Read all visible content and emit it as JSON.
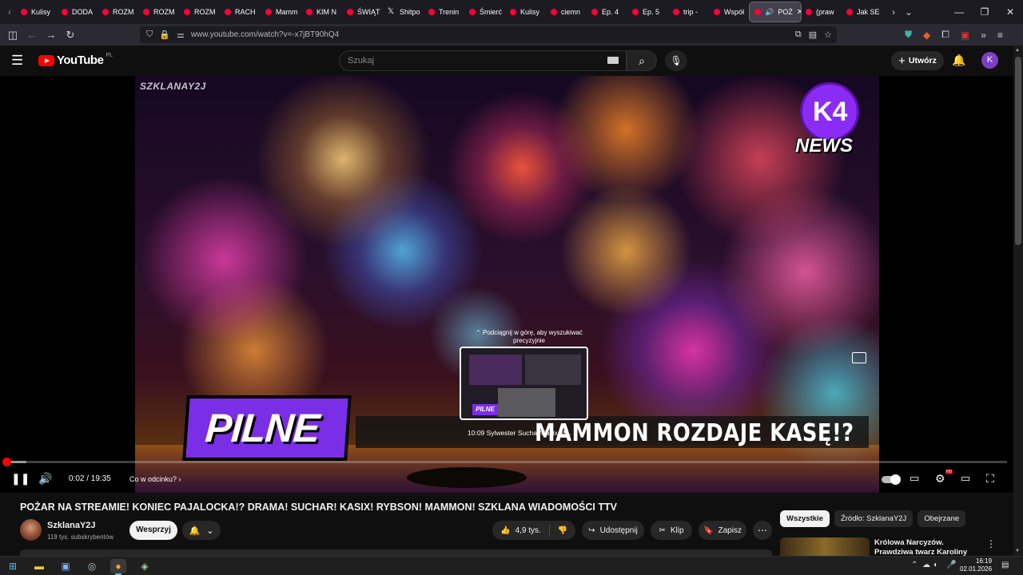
{
  "browser": {
    "tabs": [
      {
        "label": "Kulisy"
      },
      {
        "label": "DODA"
      },
      {
        "label": "ROZM"
      },
      {
        "label": "ROZM"
      },
      {
        "label": "ROZM"
      },
      {
        "label": "RACH"
      },
      {
        "label": "Mamm"
      },
      {
        "label": "KIM N"
      },
      {
        "label": "ŚWIĄT"
      },
      {
        "label": "Shitpo"
      },
      {
        "label": "Trenin"
      },
      {
        "label": "Śmierć"
      },
      {
        "label": "Kulisy"
      },
      {
        "label": "ciemn"
      },
      {
        "label": "Ep. 4"
      },
      {
        "label": "Ep. 5"
      },
      {
        "label": "trip - "
      },
      {
        "label": "Współ"
      },
      {
        "label": "POŻ"
      },
      {
        "label": "(praw"
      },
      {
        "label": "Jak SE"
      }
    ],
    "url": "www.youtube.com/watch?v=-x7jBT90hQ4"
  },
  "youtube": {
    "logo_text": "YouTube",
    "country_code": "PL",
    "search_placeholder": "Szukaj",
    "create_label": "Utwórz",
    "avatar_letter": "K"
  },
  "player": {
    "watermark": "SZKLANAY2J",
    "channel_logo_text": "K4",
    "news_label": "NEWS",
    "pilne_label": "PILNE",
    "ticker_text": "MAMMON ROZDAJE KASĘ!?",
    "scroll_hint": "⌃ Podciągnij w górę, aby wyszukiwać precyzyjnie",
    "preview_badge": "PILNE",
    "preview_caption": "10:09   Sylwester Suchar/Kasix/M...",
    "current_time": "0:02",
    "duration": "19:35",
    "time_display": "0:02 / 19:35",
    "chapter_label": "Co w odcinku? ›",
    "played_fraction": 0.002,
    "buffered_fraction": 0.02
  },
  "video": {
    "title": "POŻAR NA STREAMIE! KONIEC PAJALOCKA!? DRAMA! SUCHAR! KASIX! RYBSON! MAMMON! SZKLANA WIADOMOŚCI TTV",
    "channel_name": "SzklanaY2J",
    "subscribers": "119 tys. subskrybentów",
    "support_label": "Wesprzyj",
    "likes": "4,9 tys.",
    "share_label": "Udostępnij",
    "clip_label": "Klip",
    "save_label": "Zapisz"
  },
  "sidebar": {
    "chips": [
      {
        "label": "Wszystkie"
      },
      {
        "label": "Źródło: SzklanaY2J"
      },
      {
        "label": "Obejrzane"
      }
    ],
    "recommendation_title": "Królowa Narcyzów. Prawdziwa twarz Karoliny Domaradzkiej"
  },
  "taskbar": {
    "time": "16:19",
    "date": "02.01.2026"
  },
  "colors": {
    "youtube_red": "#ff0000",
    "background": "#0f0f0f",
    "pilne_purple": "#7a2ee6",
    "avatar_purple": "#7b3fc0"
  }
}
